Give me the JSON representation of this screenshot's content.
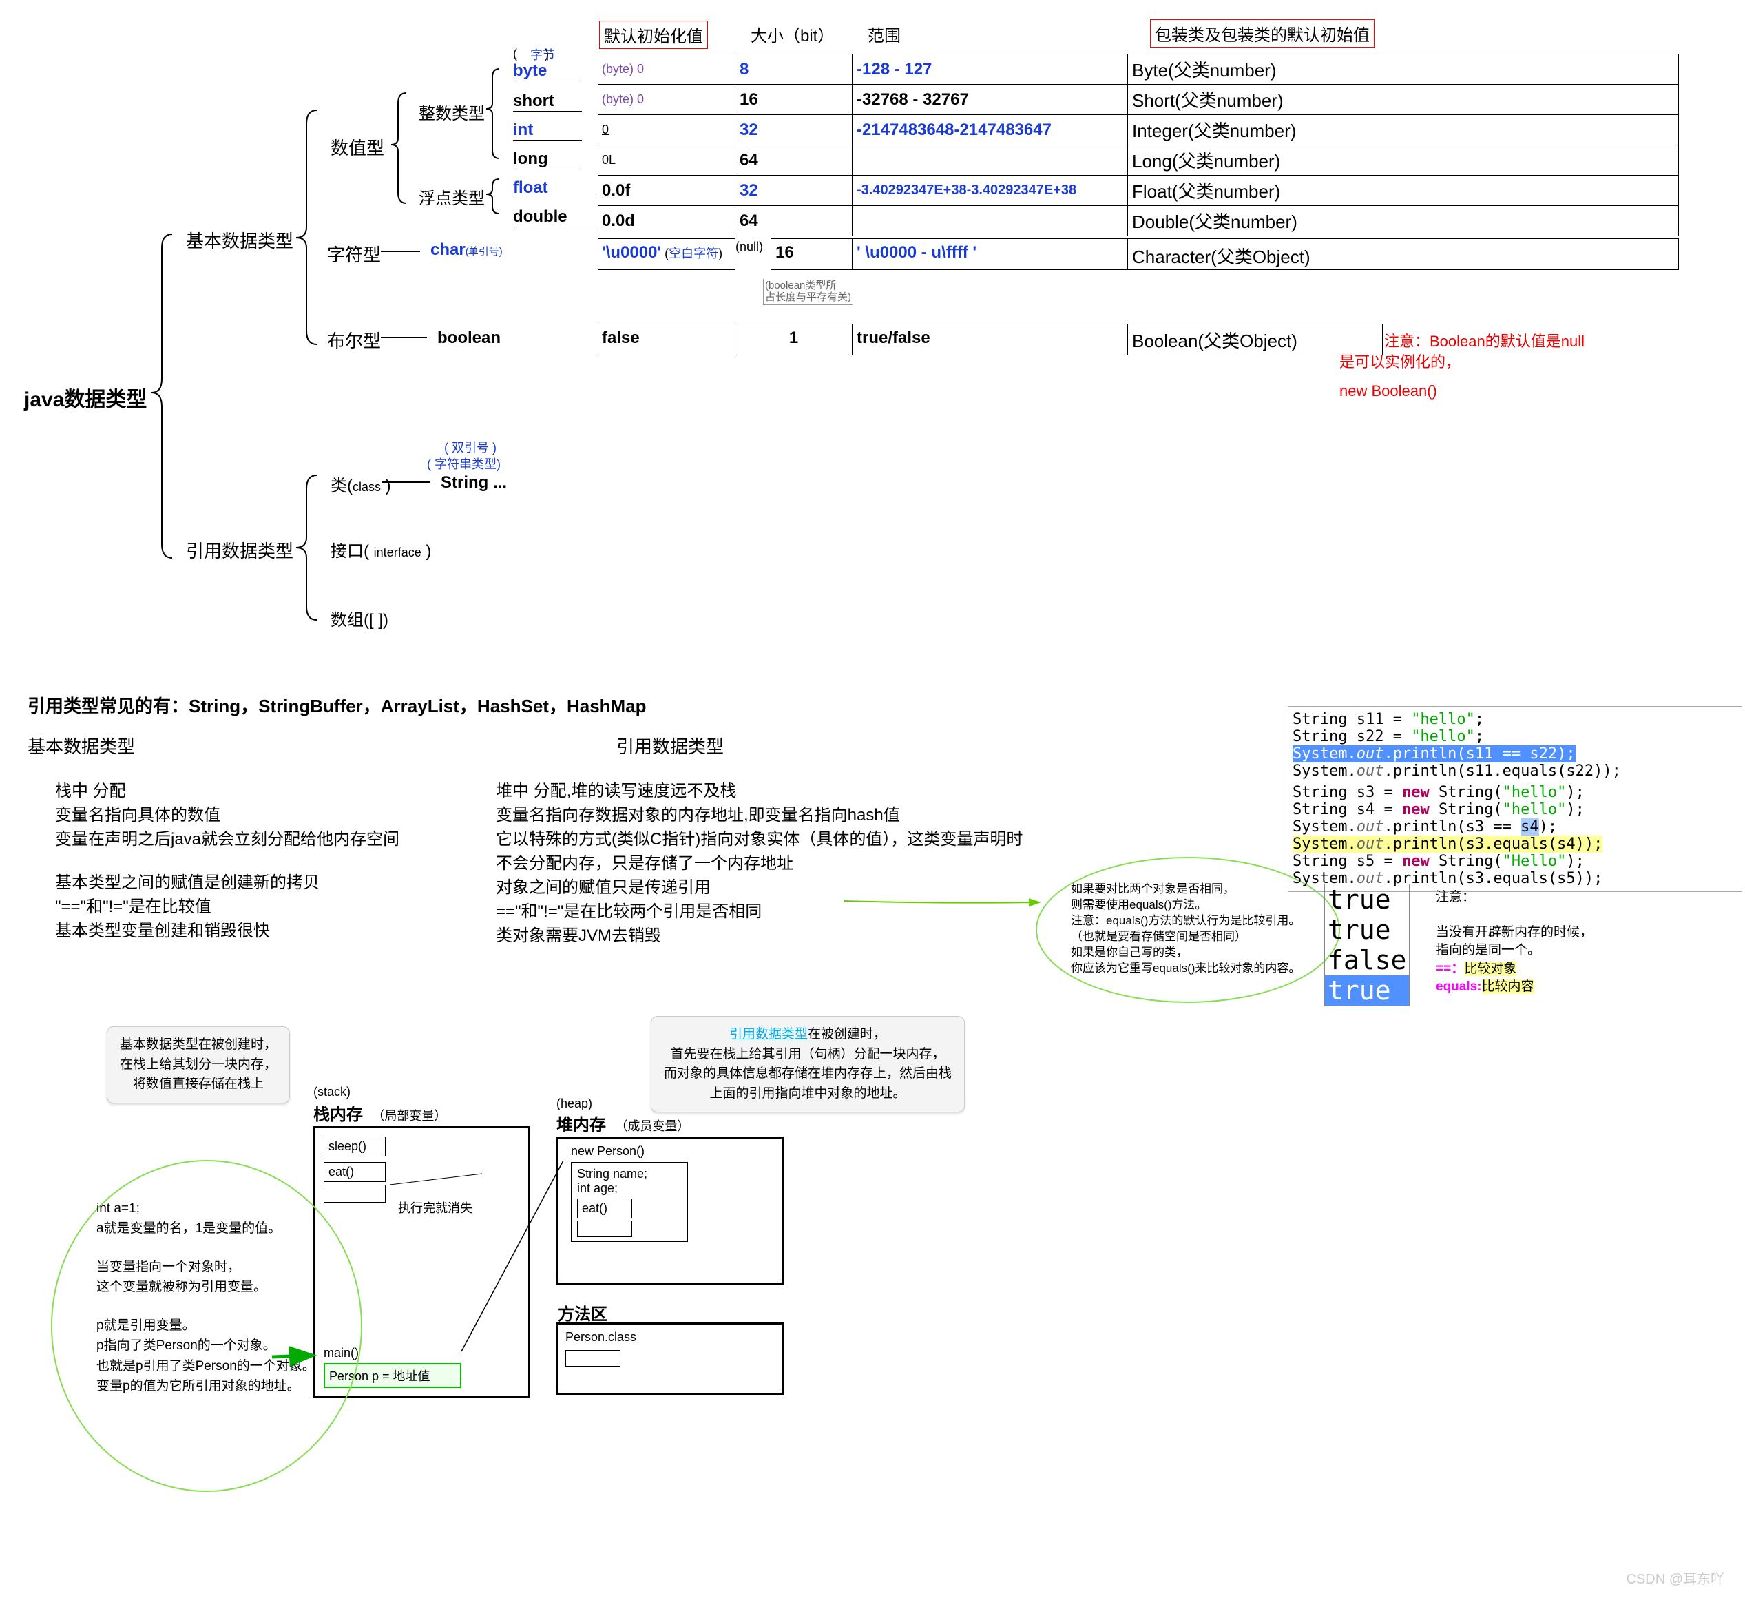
{
  "root": "java数据类型",
  "main_branches": {
    "basic": "基本数据类型",
    "ref": "引用数据类型"
  },
  "basic_sub": {
    "num": "数值型",
    "char": "字符型",
    "bool": "布尔型"
  },
  "num_sub": {
    "int": "整数类型",
    "float": "浮点类型"
  },
  "int_types": {
    "byte": "byte",
    "short": "short",
    "int": "int",
    "long": "long"
  },
  "int_note": "字节",
  "int_braces": "（ ）",
  "float_types": {
    "float": "float",
    "double": "double"
  },
  "char_type": "char",
  "char_note": "单引号",
  "char_null": "(null)",
  "char_space": "空白字符",
  "bool_type": "boolean",
  "ref_sub": {
    "class": "类",
    "class_note": "class",
    "string": "String  ...",
    "iface": "接口",
    "iface_note": "interface",
    "arr": "数组",
    "arr_note": "[ ]"
  },
  "ref_annot": {
    "dq": "双引号",
    "strtype": "字符串类型"
  },
  "headers": {
    "default": "默认初始化值",
    "size": "大小（bit）",
    "range": "范围",
    "wrapper": "包装类及包装类的默认初始值"
  },
  "rows": {
    "byte": {
      "def": "(byte) 0",
      "size": "8",
      "range": "-128 - 127",
      "wrap": "Byte(父类number)"
    },
    "short": {
      "def": "(byte)  0",
      "size": "16",
      "range": "-32768 - 32767",
      "wrap": "Short(父类number)"
    },
    "int": {
      "def": " 0",
      "size": "32",
      "range": "-2147483648-2147483647",
      "wrap": "Integer(父类number)"
    },
    "long": {
      "def": "0L",
      "size": "64",
      "range": "",
      "wrap": "Long(父类number)"
    },
    "float": {
      "def": "0.0f",
      "size": "32",
      "range": "-3.40292347E+38-3.40292347E+38",
      "wrap": "Float(父类number)"
    },
    "double": {
      "def": "0.0d",
      "size": "64",
      "range": "",
      "wrap": "Double(父类number)"
    },
    "char": {
      "def": "'\\u0000'（                ）",
      "size": "16",
      "range": "' \\u0000 - u\\ffff '",
      "wrap": "Character(父类Object)"
    },
    "bool": {
      "def": "false",
      "size": "1",
      "range": "true/false",
      "wrap": "Boolean(父类Object)"
    }
  },
  "bool_vnote": "boolean类型所\n占长度与平存有关",
  "red_note": {
    "l1": "注意：Boolean的默认值是null",
    "l2": "是可以实例化的，",
    "l3": "new Boolean()"
  },
  "section2_title": "引用类型常见的有：String，StringBuffer，ArrayList，HashSet，HashMap",
  "cmp": {
    "left_h": "基本数据类型",
    "right_h": "引用数据类型",
    "l1": "栈中        分配",
    "r1": "堆中        分配,堆的读写速度远不及栈",
    "l2": "变量名指向具体的数值",
    "r2": "变量名指向存数据对象的内存地址,即变量名指向hash值",
    "l3": "变量在声明之后java就会立刻分配给他内存空间",
    "r3": "它以特殊的方式(类似C指针)指向对象实体（具体的值），这类变量声明时不会分配内存，只是存储了一个内存地址",
    "l4": "基本类型之间的赋值是创建新的拷贝",
    "r4": "对象之间的赋值只是传递引用",
    "l5": "\"==\"和\"!=\"是在比较值",
    "r5": "==\"和\"!=\"是在比较两个引用是否相同",
    "l6": "基本类型变量创建和销毁很快",
    "r6": "类对象需要JVM去销毁"
  },
  "eq_note": {
    "l1": "如果要对比两个对象是否相同，",
    "l2": "则需要使用equals()方法。",
    "l3": "注意：equals()方法的默认行为是比较引用。",
    "l4": "（也就是要看存储空间是否相同）",
    "l5": "如果是你自己写的类，",
    "l6": "你应该为它重写equals()来比较对象的内容。"
  },
  "code_results": {
    "r1": "true",
    "r2": "true",
    "r3": "false",
    "r4": "true"
  },
  "code_note": {
    "h": "注意：",
    "l1": "当没有开辟新内存的时候，",
    "l2": "指向的是同一个。",
    "l3": "==：",
    "l3b": "比较对象",
    "l4": "equals:",
    "l4b": "比较内容"
  },
  "basic_note": {
    "l1": "基本数据类型在被创建时，",
    "l2": "在栈上给其划分一块内存，",
    "l3": "将数值直接存储在栈上"
  },
  "ref_note": {
    "hl": "引用数据类型",
    "l1": "在被创建时，",
    "l2": "首先要在栈上给其引用（句柄）分配一块内存，",
    "l3": "而对象的具体信息都存储在堆内存存上，然后由栈",
    "l4": "上面的引用指向堆中对象的地址。"
  },
  "stack": {
    "en": "(stack)",
    "cn": "栈内存",
    "sub": "（局部变量）",
    "sleep": "sleep()",
    "eat": "eat()",
    "gone": "执行完就消失",
    "main": "main()",
    "p": "Person p = 地址值"
  },
  "heap": {
    "en": "(heap)",
    "cn": "堆内存",
    "sub": "（成员变量）",
    "new": "new Person()",
    "name": "String name;",
    "age": "int age;",
    "eat": "eat()"
  },
  "method": {
    "title": "方法区",
    "cls": "Person.class"
  },
  "left_expl": {
    "l1": "int a=1;",
    "l2": "a就是变量的名，1是变量的值。",
    "l3": "当变量指向一个对象时，",
    "l4": "这个变量就被称为引用变量。",
    "l5": "p就是引用变量。",
    "l6": "p指向了类Person的一个对象。",
    "l7": "也就是p引用了类Person的一个对象。",
    "l8": "变量p的值为它所引用对象的地址。"
  },
  "watermark": "CSDN @耳东吖"
}
